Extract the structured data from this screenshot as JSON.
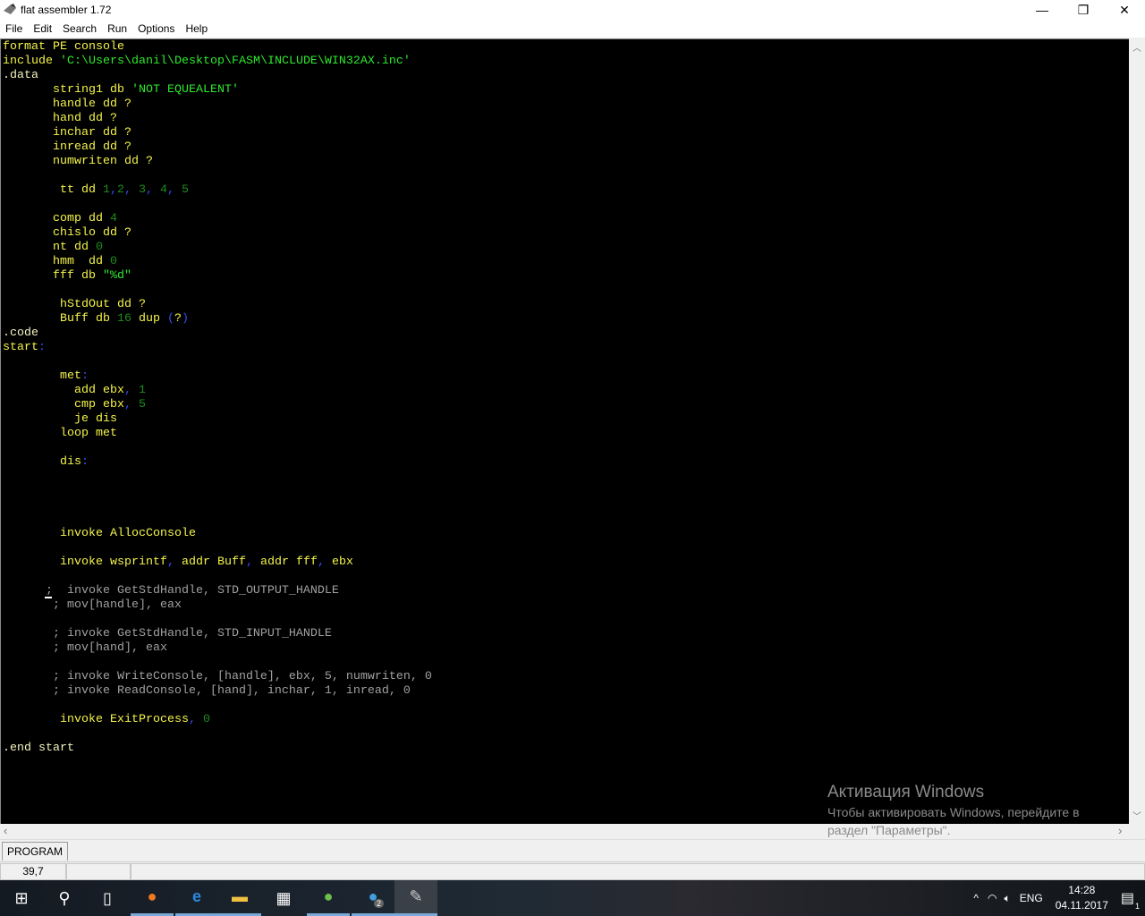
{
  "window": {
    "title": "flat assembler 1.72",
    "minimize": "—",
    "maximize": "❐",
    "close": "✕"
  },
  "menu": [
    "File",
    "Edit",
    "Search",
    "Run",
    "Options",
    "Help"
  ],
  "code": {
    "lines": [
      [
        [
          "format PE console",
          "k"
        ]
      ],
      [
        [
          "include ",
          "k"
        ],
        [
          "'C:\\Users\\danil\\Desktop\\FASM\\INCLUDE\\WIN32AX.inc'",
          "s"
        ]
      ],
      [
        [
          ".data",
          "d"
        ]
      ],
      [
        [
          "       string1 db ",
          "k"
        ],
        [
          "'NOT EQUEALENT'",
          "s"
        ]
      ],
      [
        [
          "       handle dd ?",
          "k"
        ]
      ],
      [
        [
          "       hand dd ?",
          "k"
        ]
      ],
      [
        [
          "       inchar dd ?",
          "k"
        ]
      ],
      [
        [
          "       inread dd ?",
          "k"
        ]
      ],
      [
        [
          "       numwriten dd ?",
          "k"
        ]
      ],
      [],
      [
        [
          "        tt dd ",
          "k"
        ],
        [
          "1",
          "n"
        ],
        [
          ",",
          "p"
        ],
        [
          "2",
          "n"
        ],
        [
          ", ",
          "p"
        ],
        [
          "3",
          "n"
        ],
        [
          ", ",
          "p"
        ],
        [
          "4",
          "n"
        ],
        [
          ", ",
          "p"
        ],
        [
          "5",
          "n"
        ]
      ],
      [],
      [
        [
          "       comp dd ",
          "k"
        ],
        [
          "4",
          "n"
        ]
      ],
      [
        [
          "       chislo dd ?",
          "k"
        ]
      ],
      [
        [
          "       nt dd ",
          "k"
        ],
        [
          "0",
          "n"
        ]
      ],
      [
        [
          "       hmm  dd ",
          "k"
        ],
        [
          "0",
          "n"
        ]
      ],
      [
        [
          "       fff db ",
          "k"
        ],
        [
          "\"%d\"",
          "s"
        ]
      ],
      [],
      [
        [
          "        hStdOut dd ?",
          "k"
        ]
      ],
      [
        [
          "        Buff db ",
          "k"
        ],
        [
          "16",
          "n"
        ],
        [
          " dup ",
          "k"
        ],
        [
          "(",
          "p"
        ],
        [
          "?",
          "k"
        ],
        [
          ")",
          "p"
        ]
      ],
      [
        [
          ".code",
          "d"
        ]
      ],
      [
        [
          "start",
          "k"
        ],
        [
          ":",
          "p"
        ]
      ],
      [],
      [
        [
          "        met",
          "k"
        ],
        [
          ":",
          "p"
        ]
      ],
      [
        [
          "          add ebx",
          "k"
        ],
        [
          ", ",
          "p"
        ],
        [
          "1",
          "n"
        ]
      ],
      [
        [
          "          cmp ebx",
          "k"
        ],
        [
          ", ",
          "p"
        ],
        [
          "5",
          "n"
        ]
      ],
      [
        [
          "          je dis",
          "k"
        ]
      ],
      [
        [
          "        loop met",
          "k"
        ]
      ],
      [],
      [
        [
          "        dis",
          "k"
        ],
        [
          ":",
          "p"
        ]
      ],
      [],
      [],
      [],
      [],
      [
        [
          "        invoke AllocConsole",
          "k"
        ]
      ],
      [],
      [
        [
          "        invoke wsprintf",
          "k"
        ],
        [
          ", ",
          "p"
        ],
        [
          "addr Buff",
          "k"
        ],
        [
          ", ",
          "p"
        ],
        [
          "addr fff",
          "k"
        ],
        [
          ", ",
          "p"
        ],
        [
          "ebx",
          "k"
        ]
      ],
      [],
      [
        [
          "      ;  invoke GetStdHandle, STD_OUTPUT_HANDLE",
          "c"
        ]
      ],
      [
        [
          "       ; mov[handle], eax",
          "c"
        ]
      ],
      [],
      [
        [
          "       ; invoke GetStdHandle, STD_INPUT_HANDLE",
          "c"
        ]
      ],
      [
        [
          "       ; mov[hand], eax",
          "c"
        ]
      ],
      [],
      [
        [
          "       ; invoke WriteConsole, [handle], ebx, 5, numwriten, 0",
          "c"
        ]
      ],
      [
        [
          "       ; invoke ReadConsole, [hand], inchar, 1, inread, 0",
          "c"
        ]
      ],
      [],
      [
        [
          "        invoke ExitProcess",
          "k"
        ],
        [
          ", ",
          "p"
        ],
        [
          "0",
          "n"
        ]
      ],
      [],
      [
        [
          ".end start",
          "d"
        ]
      ]
    ]
  },
  "watermark": {
    "title": "Активация Windows",
    "line1": "Чтобы активировать Windows, перейдите в",
    "line2": "раздел \"Параметры\"."
  },
  "tab": "PROGRAM",
  "status": {
    "position": "39,7"
  },
  "taskbar": {
    "lang": "ENG",
    "time": "14:28",
    "date": "04.11.2017",
    "notifications": "1",
    "telegram_badge": "2"
  }
}
